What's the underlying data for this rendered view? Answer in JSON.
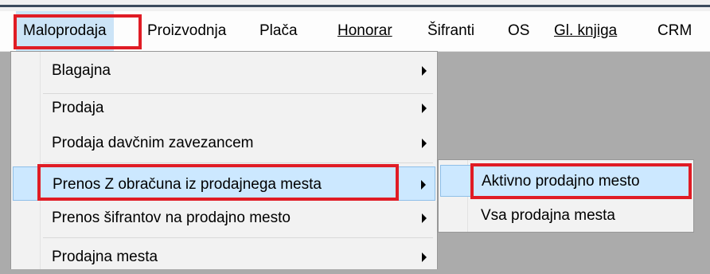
{
  "menubar": {
    "items": [
      {
        "label": "Maloprodaja"
      },
      {
        "label": "Proizvodnja"
      },
      {
        "label": "Plača"
      },
      {
        "label": "Honorar"
      },
      {
        "label": "Šifranti"
      },
      {
        "label": "OS"
      },
      {
        "label": "Gl. knjiga"
      },
      {
        "label": "CRM"
      }
    ]
  },
  "dropdown": {
    "items": [
      {
        "label": "Blagajna",
        "has_submenu": true
      },
      {
        "label": "Prodaja",
        "has_submenu": true
      },
      {
        "label": "Prodaja davčnim zavezancem",
        "has_submenu": true
      },
      {
        "label": "Prenos Z obračuna iz prodajnega mesta",
        "has_submenu": true,
        "highlighted": true
      },
      {
        "label": "Prenos šifrantov na prodajno mesto",
        "has_submenu": true
      },
      {
        "label": "Prodajna mesta",
        "has_submenu": true
      }
    ]
  },
  "submenu": {
    "items": [
      {
        "label": "Aktivno prodajno mesto",
        "highlighted": true
      },
      {
        "label": "Vsa prodajna mesta"
      }
    ]
  },
  "colors": {
    "highlight": "#cce8ff",
    "annotation_red": "#e01c25",
    "workspace": "#ababab"
  }
}
